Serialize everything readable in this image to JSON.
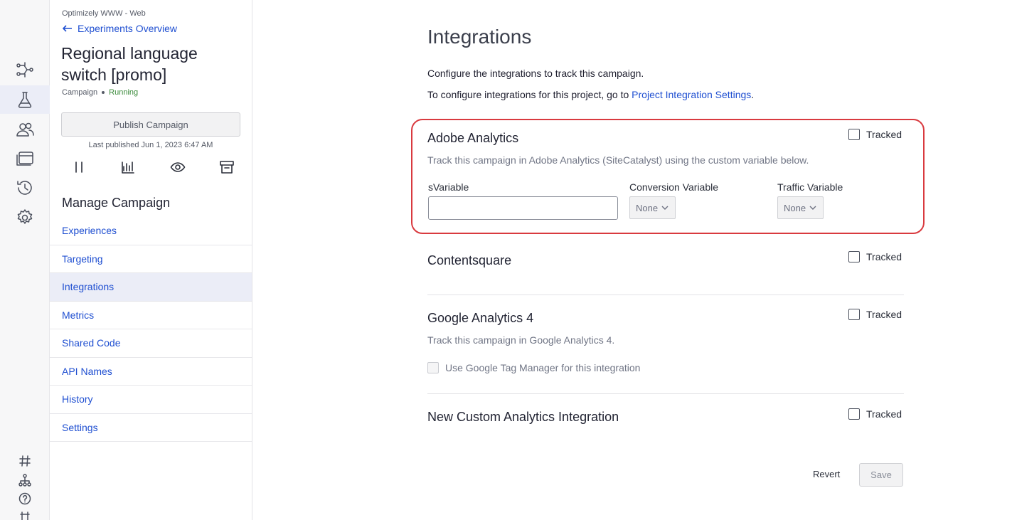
{
  "sidebar": {
    "project": "Optimizely WWW - Web",
    "back_label": "Experiments Overview",
    "campaign_title": "Regional language switch [promo]",
    "campaign_type": "Campaign",
    "campaign_status": "Running",
    "publish_label": "Publish Campaign",
    "last_published": "Last published Jun 1, 2023 6:47 AM",
    "manage_title": "Manage Campaign",
    "nav": [
      {
        "label": "Experiences"
      },
      {
        "label": "Targeting"
      },
      {
        "label": "Integrations",
        "active": true
      },
      {
        "label": "Metrics"
      },
      {
        "label": "Shared Code"
      },
      {
        "label": "API Names"
      },
      {
        "label": "History"
      },
      {
        "label": "Settings"
      }
    ]
  },
  "rail": {
    "icons": [
      "flow-icon",
      "flask-icon",
      "audiences-icon",
      "pages-icon",
      "history-icon",
      "settings-icon"
    ],
    "bottom_icons": [
      "hash-icon",
      "sitemap-icon",
      "help-icon",
      "plugin-icon"
    ]
  },
  "main": {
    "title": "Integrations",
    "intro": "Configure the integrations to track this campaign.",
    "project_settings_prefix": "To configure integrations for this project, go to",
    "project_settings_link": "Project Integration Settings",
    "project_settings_suffix": ".",
    "integrations": [
      {
        "name": "Adobe Analytics",
        "tracked_label": "Tracked",
        "description": "Track this campaign in Adobe Analytics (SiteCatalyst) using the custom variable below.",
        "svariable_label": "sVariable",
        "svariable_value": "",
        "conversion_label": "Conversion Variable",
        "conversion_value": "None",
        "traffic_label": "Traffic Variable",
        "traffic_value": "None"
      },
      {
        "name": "Contentsquare",
        "tracked_label": "Tracked"
      },
      {
        "name": "Google Analytics 4",
        "tracked_label": "Tracked",
        "description": "Track this campaign in Google Analytics 4.",
        "gtm_label": "Use Google Tag Manager for this integration"
      },
      {
        "name": "New Custom Analytics Integration",
        "tracked_label": "Tracked"
      }
    ],
    "revert_label": "Revert",
    "save_label": "Save"
  },
  "colors": {
    "link": "#1f4fd1",
    "highlight": "#d93a3f",
    "running": "#3a8a3a",
    "nav_active_bg": "#ebedf7"
  }
}
